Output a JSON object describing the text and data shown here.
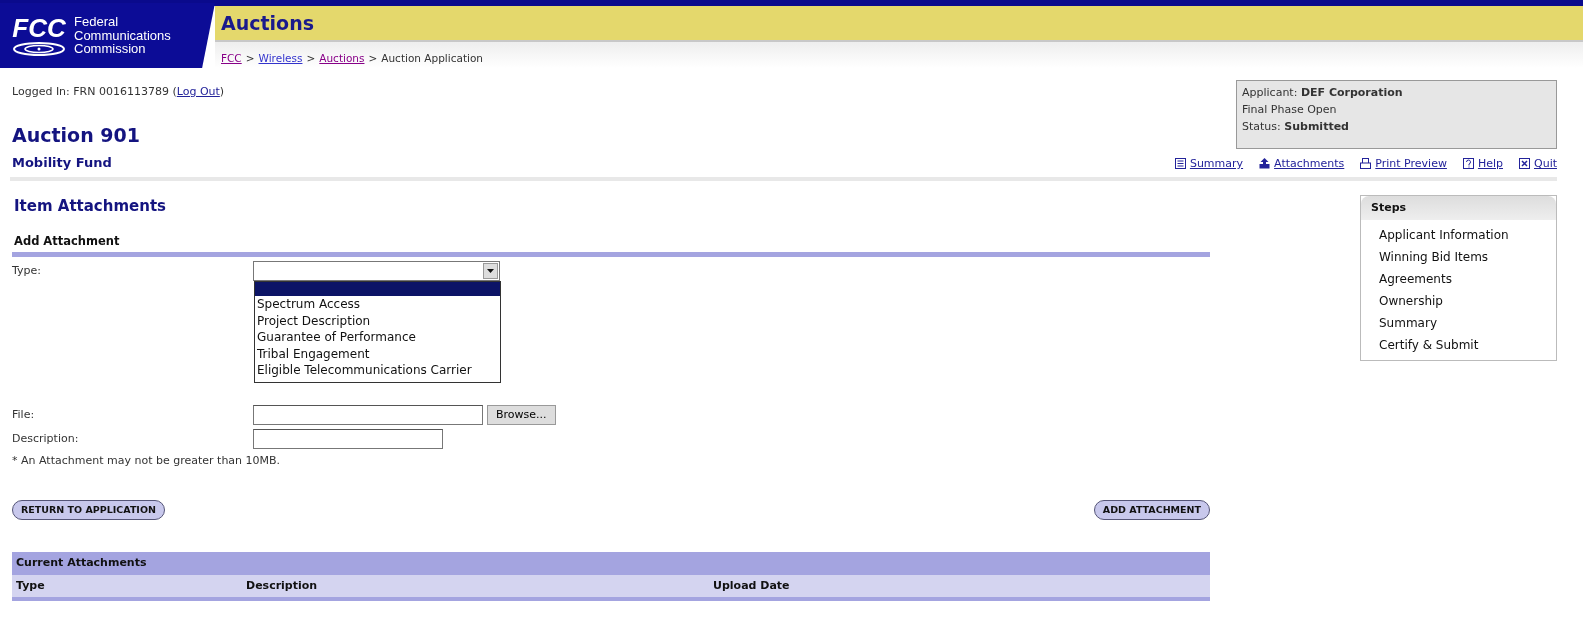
{
  "header": {
    "agency_line_1": "Federal",
    "agency_line_2": "Communications",
    "agency_line_3": "Commission",
    "logo_text": "FCC",
    "title": "Auctions"
  },
  "breadcrumb": [
    {
      "label": "FCC",
      "link": true,
      "visited": true
    },
    {
      "label": "Wireless",
      "link": true,
      "visited": false
    },
    {
      "label": "Auctions",
      "link": true,
      "visited": true
    },
    {
      "label": "Auction Application",
      "link": false,
      "visited": false
    }
  ],
  "breadcrumb_separator": ">",
  "login": {
    "text": "Logged In: FRN 0016113789 (",
    "link": "Log Out",
    "close": ")"
  },
  "applicant_box": {
    "applicant_label": "Applicant:",
    "applicant": "DEF Corporation",
    "phase": "Final Phase Open",
    "status_label": "Status:",
    "status": "Submitted"
  },
  "auction_title": "Auction 901",
  "auction_subtitle": "Mobility Fund",
  "toolbar_links": [
    {
      "label": "Summary",
      "kind": "list"
    },
    {
      "label": "Attachments",
      "kind": "upload"
    },
    {
      "label": "Print Preview",
      "kind": "print"
    },
    {
      "label": "Help",
      "kind": "help"
    },
    {
      "label": "Quit",
      "kind": "close"
    }
  ],
  "page_title": "Item Attachments",
  "section_title": "Add Attachment",
  "type_field": {
    "label": "Type:",
    "expanded": true,
    "blank_option_highlighted": true,
    "options": [
      {
        "label": "Spectrum Access",
        "selected": false
      },
      {
        "label": "Project Description",
        "selected": false
      },
      {
        "label": "Guarantee of Performance",
        "selected": false
      },
      {
        "label": "Tribal Engagement",
        "selected": false
      },
      {
        "label": "Eligible Telecommunications Carrier",
        "selected": false
      }
    ]
  },
  "file_field": {
    "label": "File:",
    "browse_button": "Browse..."
  },
  "description_field": {
    "label": "Description:"
  },
  "note": "* An Attachment may not be greater than 10MB.",
  "buttons": {
    "return": "RETURN TO APPLICATION",
    "add": "ADD ATTACHMENT"
  },
  "attachments_table": {
    "title": "Current Attachments",
    "columns": [
      "Type",
      "Description",
      "Upload Date"
    ]
  },
  "steps": {
    "title": "Steps",
    "items": [
      {
        "label": "Applicant Information",
        "selected": false
      },
      {
        "label": "Winning Bid Items",
        "selected": false
      },
      {
        "label": "Agreements",
        "selected": false
      },
      {
        "label": "Ownership",
        "selected": false
      },
      {
        "label": "Summary",
        "selected": false
      },
      {
        "label": "Certify & Submit",
        "selected": false
      }
    ]
  }
}
